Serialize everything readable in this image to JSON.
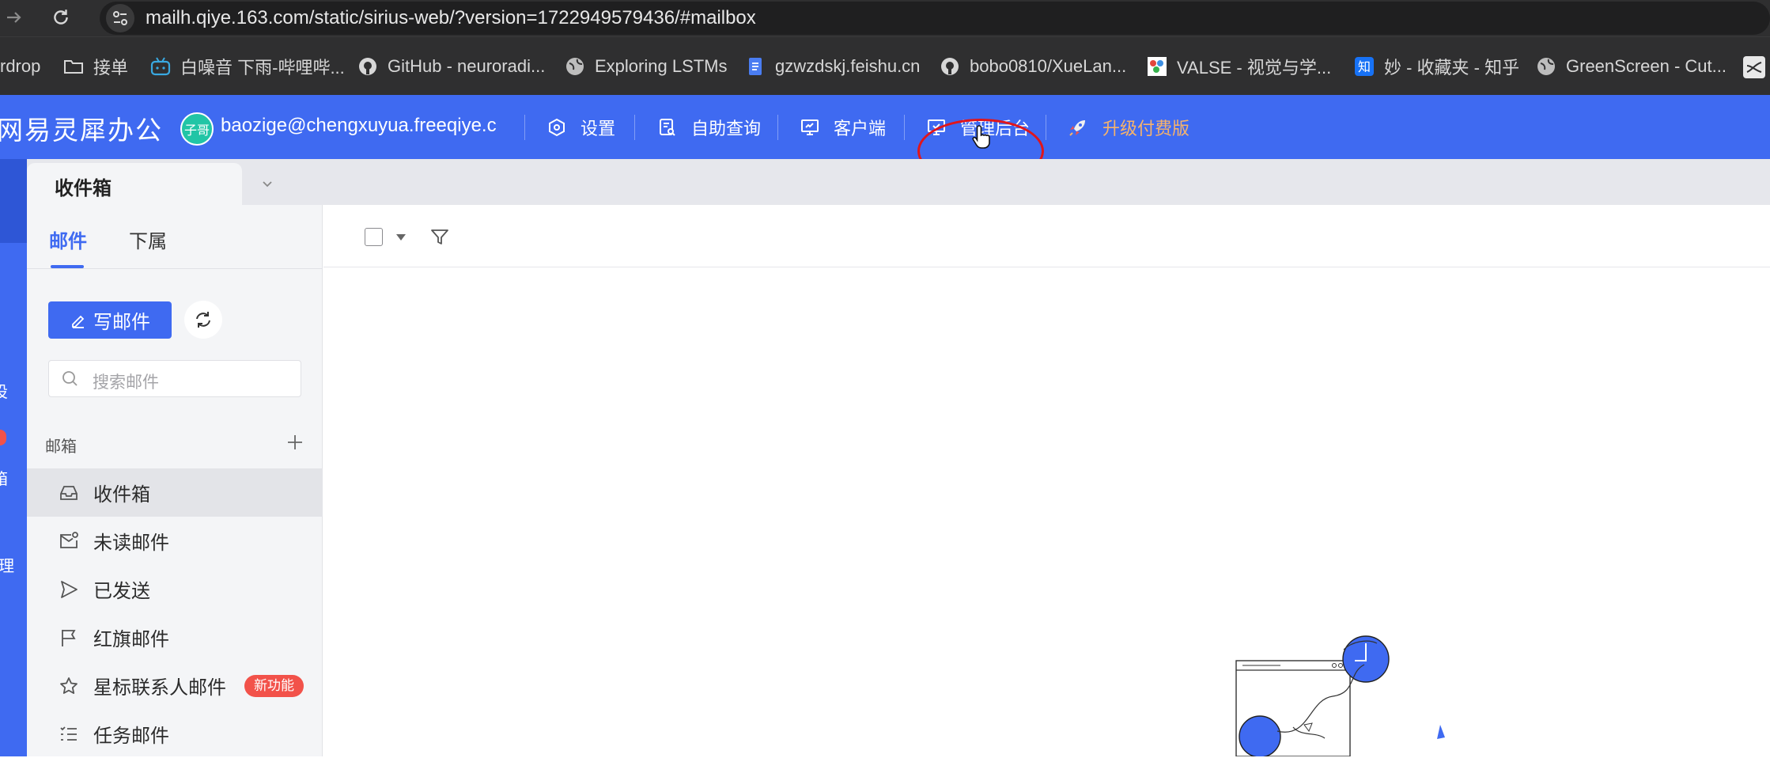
{
  "browser": {
    "url": "mailh.qiye.163.com/static/sirius-web/?version=1722949579436/#mailbox",
    "bookmarks": [
      {
        "label": "rdrop",
        "icon": "none"
      },
      {
        "label": "接单",
        "icon": "folder-icon"
      },
      {
        "label": "白噪音 下雨-哔哩哔...",
        "icon": "bilibili-icon"
      },
      {
        "label": "GitHub - neuroradi...",
        "icon": "github-icon"
      },
      {
        "label": "Exploring LSTMs",
        "icon": "globe-icon"
      },
      {
        "label": "gzwzdskj.feishu.cn",
        "icon": "doc-icon"
      },
      {
        "label": "bobo0810/XueLan...",
        "icon": "github-icon"
      },
      {
        "label": "VALSE - 视觉与学...",
        "icon": "valse-icon"
      },
      {
        "label": "妙 - 收藏夹 - 知乎",
        "icon": "zhihu-icon"
      },
      {
        "label": "GreenScreen - Cut...",
        "icon": "globe-icon"
      }
    ]
  },
  "app": {
    "brand": "网易灵犀办公",
    "avatar_text": "子哥",
    "account": "baozige@chengxuyua.freeqiye.c",
    "nav": [
      {
        "label": "设置",
        "icon": "settings-hex-icon"
      },
      {
        "label": "自助查询",
        "icon": "query-doc-icon"
      },
      {
        "label": "客户端",
        "icon": "monitor-icon"
      },
      {
        "label": "管理后台",
        "icon": "admin-monitor-icon"
      },
      {
        "label": "升级付费版",
        "icon": "rocket-icon"
      }
    ],
    "upgrade_color": "#f7b36b",
    "accent": "#3f6af1",
    "left_strip_fragments": [
      "设",
      "箱",
      "理"
    ]
  },
  "mailbox": {
    "tab_title": "收件箱",
    "subtabs": [
      "邮件",
      "下属"
    ],
    "compose_label": "写邮件",
    "search_placeholder": "搜索邮件",
    "section_title": "邮箱",
    "folders": [
      {
        "label": "收件箱",
        "icon": "inbox-icon",
        "active": true
      },
      {
        "label": "未读邮件",
        "icon": "unread-mail-icon"
      },
      {
        "label": "已发送",
        "icon": "send-icon"
      },
      {
        "label": "红旗邮件",
        "icon": "flag-icon"
      },
      {
        "label": "星标联系人邮件",
        "icon": "star-icon",
        "badge": "新功能"
      },
      {
        "label": "任务邮件",
        "icon": "task-list-icon"
      }
    ],
    "badge_color": "#f2524a"
  }
}
